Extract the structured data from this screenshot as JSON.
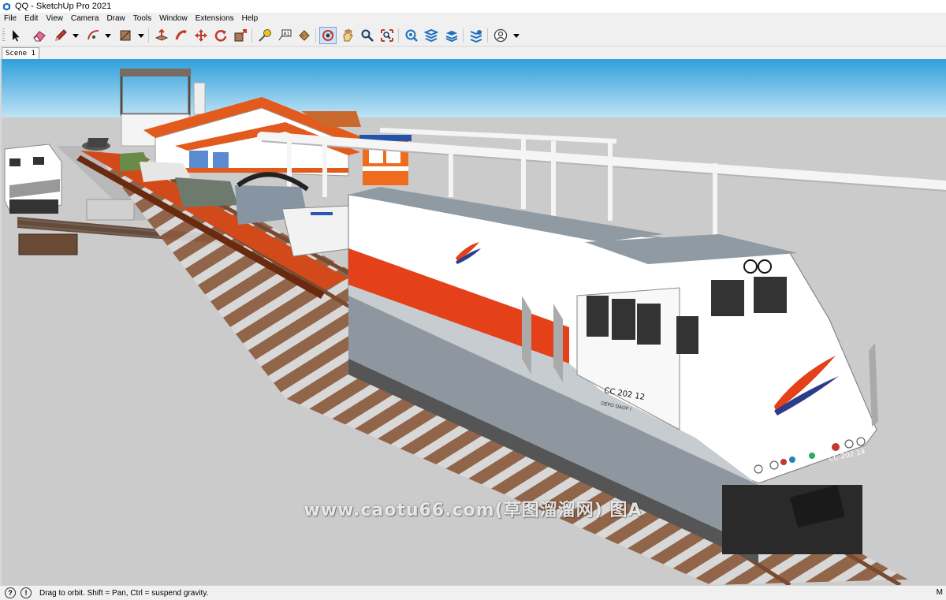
{
  "window": {
    "title": "QQ - SketchUp Pro 2021"
  },
  "menu": [
    "File",
    "Edit",
    "View",
    "Camera",
    "Draw",
    "Tools",
    "Window",
    "Extensions",
    "Help"
  ],
  "toolbar": {
    "tools": [
      "select",
      "eraser",
      "pencil",
      "arc",
      "rectangle",
      "push-pull",
      "follow-me",
      "move",
      "rotate",
      "scale",
      "tape-measure",
      "text",
      "paint-bucket",
      "orbit",
      "pan",
      "zoom",
      "zoom-extents",
      "3d-warehouse",
      "extension-warehouse",
      "layout",
      "extension-manager",
      "account"
    ],
    "active_tool": "orbit"
  },
  "scenes": {
    "tabs": [
      "Scene 1"
    ]
  },
  "viewport": {
    "sky_color": "#4fb0e0",
    "ground_color": "#c9c9c9",
    "locomotive_plate": "CC 202 12",
    "locomotive_front_plate": "CC 202 14",
    "depot_text": "DEPO DAOP I"
  },
  "watermark": "www.caotu66.com(草图溜溜网) 图A",
  "status": {
    "text": "Drag to orbit. Shift = Pan, Ctrl = suspend gravity.",
    "right": "M"
  }
}
